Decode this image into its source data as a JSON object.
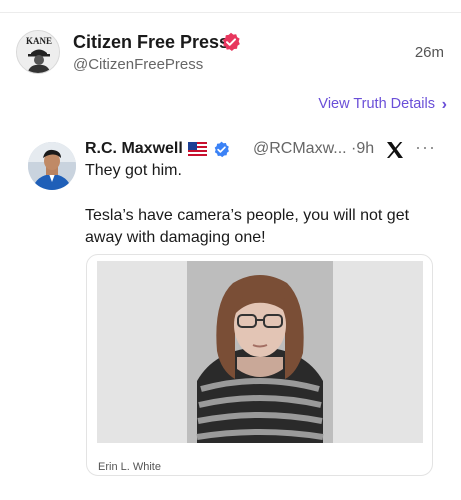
{
  "post": {
    "author_name": "Citizen Free Press",
    "author_handle": "@CitizenFreePress",
    "time": "26m",
    "avatar_text": "KANE",
    "verified_color": "#e8365d"
  },
  "truth_details": {
    "label": "View Truth Details",
    "chevron": "›",
    "color": "#6a4fd8"
  },
  "quote": {
    "name": "R.C. Maxwell",
    "handle": "@RCMaxw...",
    "time_sep": "·9h",
    "more": "···",
    "text_1": "They got him.",
    "text_2": "Tesla’s have camera’s people, you will not get away with damaging one!",
    "verified_color": "#3b82f6"
  },
  "card": {
    "caption": "Erin L. White"
  }
}
